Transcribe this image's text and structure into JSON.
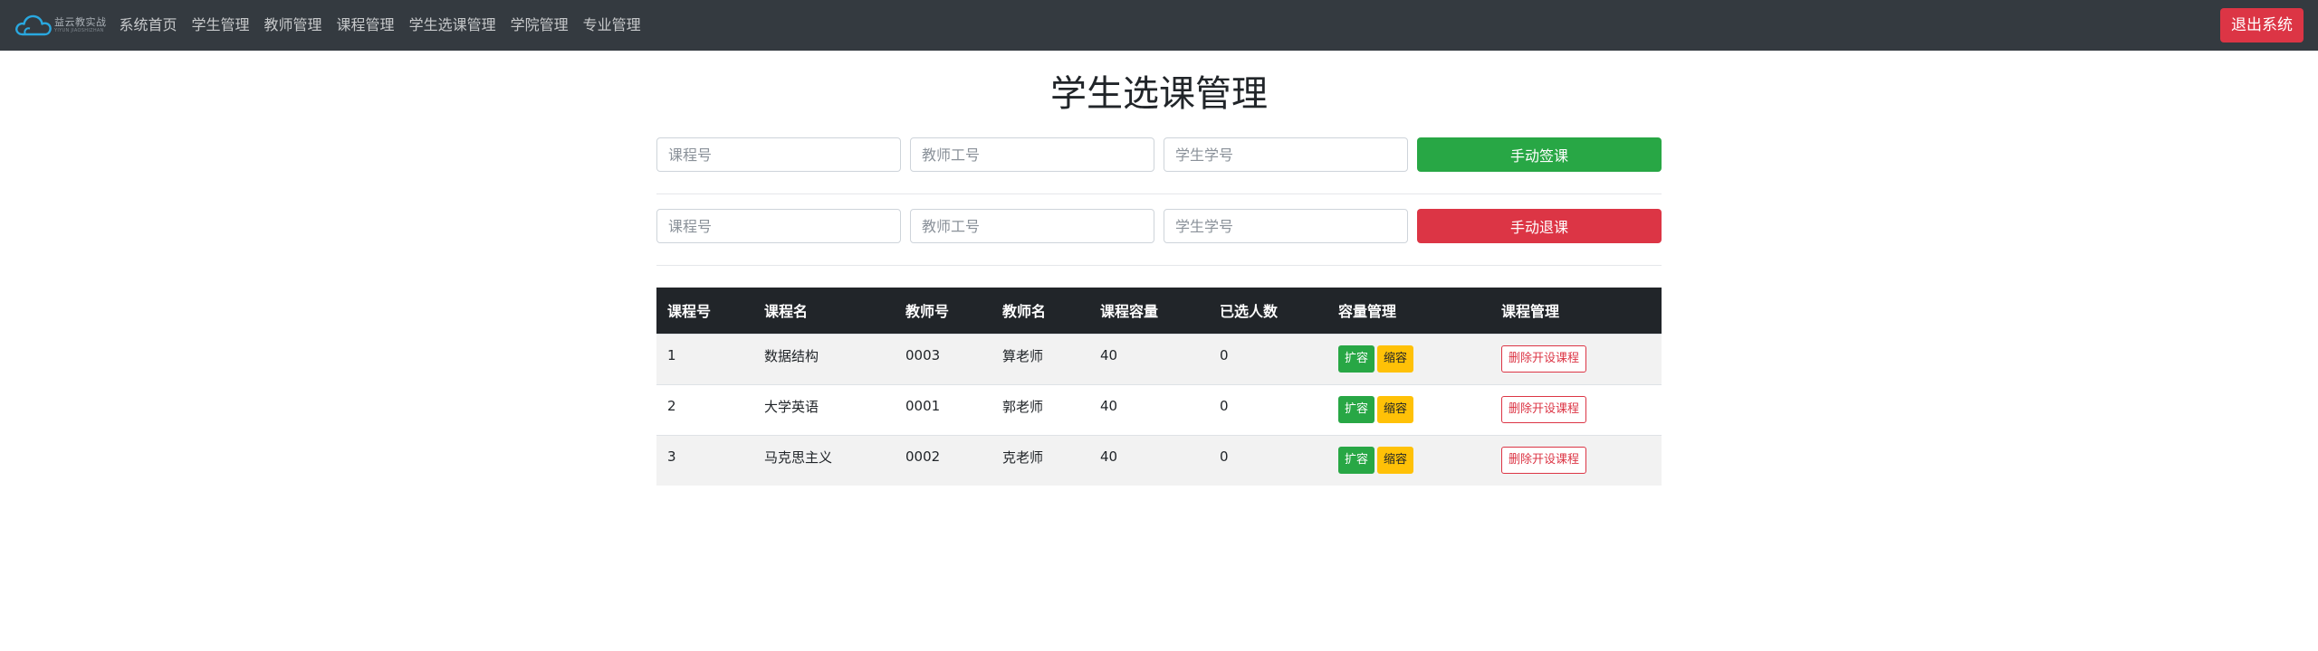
{
  "nav": {
    "brand_name": "益云教实战",
    "brand_sub": "YIYUN JIAOSHIZHAN",
    "links": [
      "系统首页",
      "学生管理",
      "教师管理",
      "课程管理",
      "学生选课管理",
      "学院管理",
      "专业管理"
    ],
    "logout": "退出系统"
  },
  "page": {
    "title": "学生选课管理"
  },
  "enroll_form": {
    "course_placeholder": "课程号",
    "teacher_placeholder": "教师工号",
    "student_placeholder": "学生学号",
    "submit": "手动签课"
  },
  "drop_form": {
    "course_placeholder": "课程号",
    "teacher_placeholder": "教师工号",
    "student_placeholder": "学生学号",
    "submit": "手动退课"
  },
  "table": {
    "headers": [
      "课程号",
      "课程名",
      "教师号",
      "教师名",
      "课程容量",
      "已选人数",
      "容量管理",
      "课程管理"
    ],
    "rows": [
      {
        "course_id": "1",
        "course_name": "数据结构",
        "teacher_id": "0003",
        "teacher_name": "算老师",
        "capacity": "40",
        "enrolled": "0"
      },
      {
        "course_id": "2",
        "course_name": "大学英语",
        "teacher_id": "0001",
        "teacher_name": "郭老师",
        "capacity": "40",
        "enrolled": "0"
      },
      {
        "course_id": "3",
        "course_name": "马克思主义",
        "teacher_id": "0002",
        "teacher_name": "克老师",
        "capacity": "40",
        "enrolled": "0"
      }
    ],
    "expand_label": "扩容",
    "shrink_label": "缩容",
    "delete_label": "删除开设课程"
  },
  "colors": {
    "navbar": "#343a40",
    "success": "#28a745",
    "danger": "#dc3545",
    "warning": "#ffc107",
    "table_head": "#212529"
  },
  "icons": {
    "brand": "cloud-logo-icon"
  }
}
